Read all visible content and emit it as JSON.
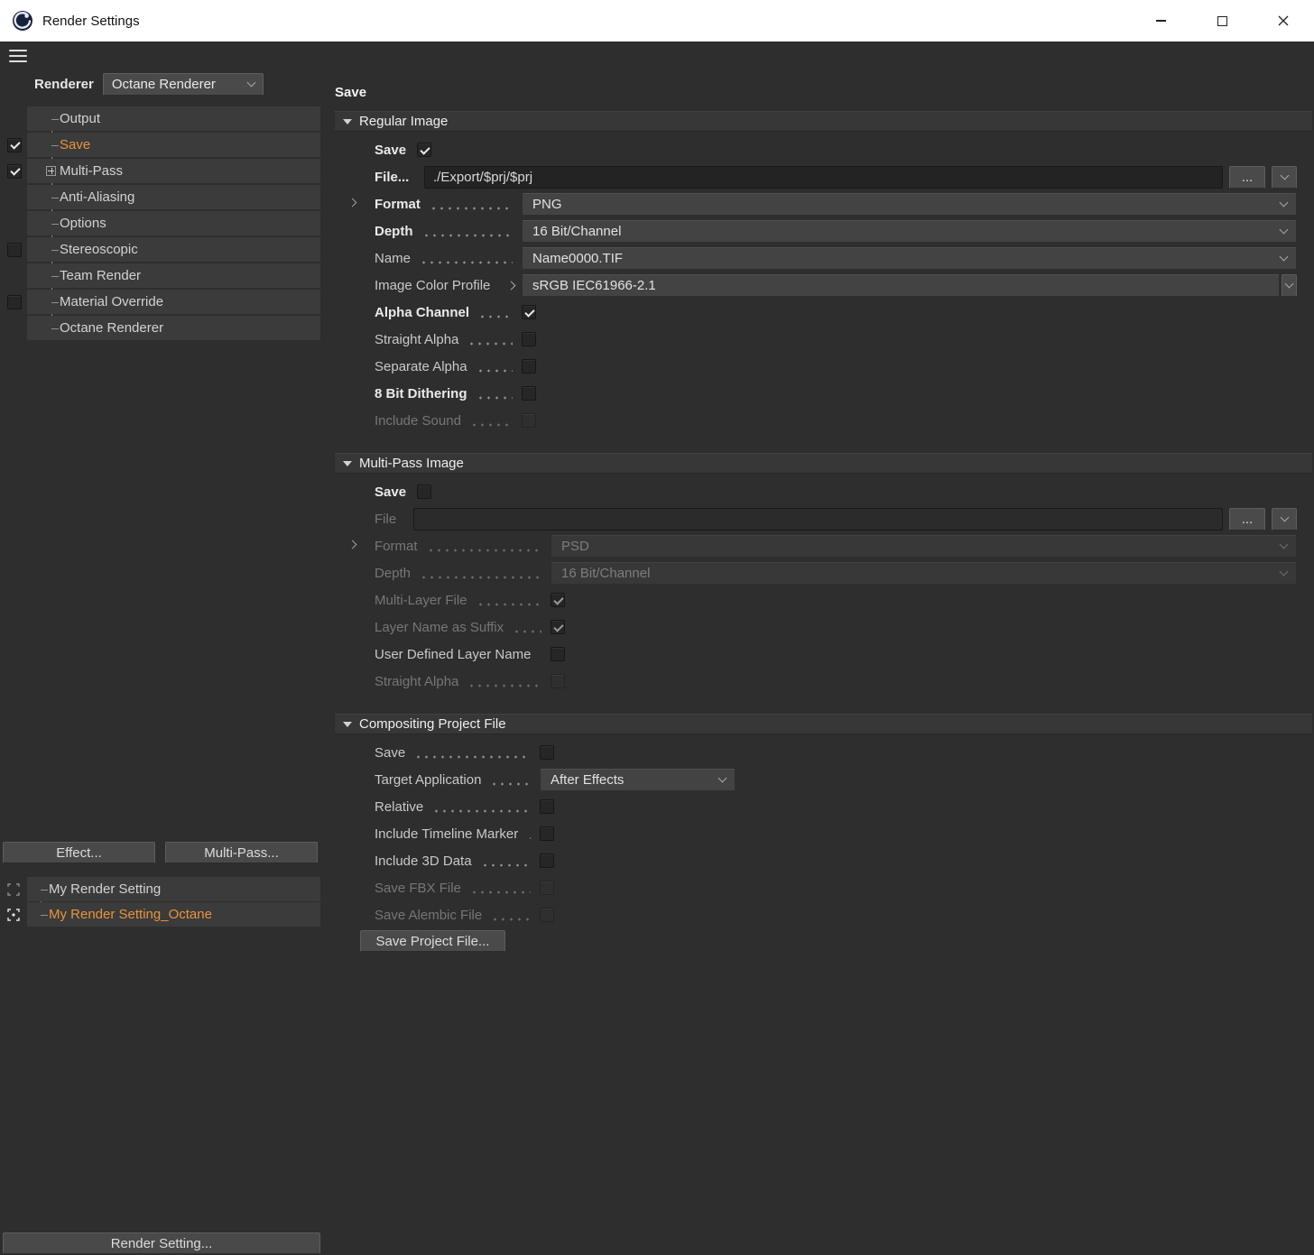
{
  "window": {
    "title": "Render Settings"
  },
  "colors": {
    "accent": "#e8933c",
    "titlebar_bg": "#ffffff",
    "panel_bg": "#2e2e2e",
    "row_bg": "#3b3b3b"
  },
  "sidebar": {
    "renderer_label": "Renderer",
    "renderer_value": "Octane Renderer",
    "tree": [
      {
        "label": "Output",
        "selected": false
      },
      {
        "label": "Save",
        "selected": true,
        "checked": true
      },
      {
        "label": "Multi-Pass",
        "selected": false,
        "checked": true,
        "has_expand": true
      },
      {
        "label": "Anti-Aliasing",
        "selected": false
      },
      {
        "label": "Options",
        "selected": false
      },
      {
        "label": "Stereoscopic",
        "selected": false,
        "checked": false
      },
      {
        "label": "Team Render",
        "selected": false
      },
      {
        "label": "Material Override",
        "selected": false,
        "checked": false
      },
      {
        "label": "Octane Renderer",
        "selected": false
      }
    ],
    "effect_button": "Effect...",
    "multipass_button": "Multi-Pass...",
    "presets": [
      {
        "label": "My Render Setting",
        "selected": false
      },
      {
        "label": "My Render Setting_Octane",
        "selected": true
      }
    ],
    "render_setting_button": "Render Setting..."
  },
  "main": {
    "panel_title": "Save",
    "regular": {
      "header": "Regular Image",
      "save": {
        "label": "Save",
        "checked": true
      },
      "file": {
        "label": "File...",
        "value": "./Export/$prj/$prj",
        "browse": "..."
      },
      "format": {
        "label": "Format",
        "value": "PNG"
      },
      "depth": {
        "label": "Depth",
        "value": "16 Bit/Channel"
      },
      "name": {
        "label": "Name",
        "value": "Name0000.TIF"
      },
      "color_profile": {
        "label": "Image Color Profile",
        "value": "sRGB IEC61966-2.1"
      },
      "alpha": {
        "label": "Alpha Channel",
        "checked": true
      },
      "straight_alpha": {
        "label": "Straight Alpha",
        "checked": false
      },
      "separate_alpha": {
        "label": "Separate Alpha",
        "checked": false
      },
      "dithering": {
        "label": "8 Bit Dithering",
        "checked": false
      },
      "include_sound": {
        "label": "Include Sound",
        "checked": false
      }
    },
    "multipass": {
      "header": "Multi-Pass Image",
      "save": {
        "label": "Save",
        "checked": false
      },
      "file": {
        "label": "File",
        "value": "",
        "browse": "..."
      },
      "format": {
        "label": "Format",
        "value": "PSD"
      },
      "depth": {
        "label": "Depth",
        "value": "16 Bit/Channel"
      },
      "multilayer": {
        "label": "Multi-Layer File",
        "checked": true
      },
      "suffix": {
        "label": "Layer Name as Suffix",
        "checked": true
      },
      "userdef": {
        "label": "User Defined Layer Name",
        "checked": false
      },
      "straight": {
        "label": "Straight Alpha",
        "checked": false
      }
    },
    "compositing": {
      "header": "Compositing Project File",
      "save": {
        "label": "Save",
        "checked": false
      },
      "target": {
        "label": "Target Application",
        "value": "After Effects"
      },
      "relative": {
        "label": "Relative",
        "checked": false
      },
      "timeline": {
        "label": "Include Timeline Marker",
        "checked": false
      },
      "data3d": {
        "label": "Include 3D Data",
        "checked": false
      },
      "fbx": {
        "label": "Save FBX File",
        "checked": false
      },
      "alembic": {
        "label": "Save Alembic File",
        "checked": false
      },
      "save_project_button": "Save Project File..."
    }
  }
}
